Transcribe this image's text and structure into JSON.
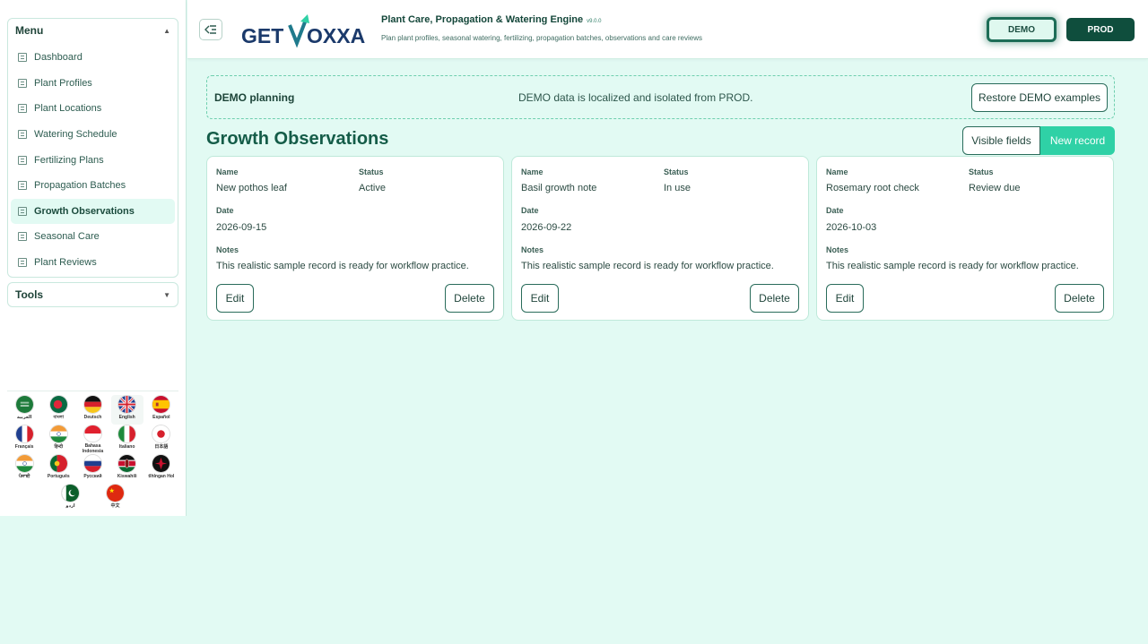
{
  "sidebar": {
    "menu_title": "Menu",
    "tools_title": "Tools",
    "items": [
      {
        "label": "Dashboard"
      },
      {
        "label": "Plant Profiles"
      },
      {
        "label": "Plant Locations"
      },
      {
        "label": "Watering Schedule"
      },
      {
        "label": "Fertilizing Plans"
      },
      {
        "label": "Propagation Batches"
      },
      {
        "label": "Growth Observations",
        "active": true
      },
      {
        "label": "Seasonal Care"
      },
      {
        "label": "Plant Reviews"
      }
    ],
    "languages": [
      {
        "label": "العربية",
        "flag": "saudi"
      },
      {
        "label": "বাংলা",
        "flag": "bangladesh"
      },
      {
        "label": "Deutsch",
        "flag": "germany"
      },
      {
        "label": "English",
        "flag": "uk",
        "selected": true
      },
      {
        "label": "Español",
        "flag": "spain"
      },
      {
        "label": "Français",
        "flag": "france"
      },
      {
        "label": "हिन्दी",
        "flag": "india"
      },
      {
        "label": "Bahasa Indonesia",
        "flag": "indonesia"
      },
      {
        "label": "Italiano",
        "flag": "italy"
      },
      {
        "label": "日本語",
        "flag": "japan"
      },
      {
        "label": "ਪੰਜਾਬੀ",
        "flag": "india"
      },
      {
        "label": "Português",
        "flag": "portugal"
      },
      {
        "label": "Русский",
        "flag": "russia"
      },
      {
        "label": "Kiswahili",
        "flag": "kenya"
      },
      {
        "label": "tlhIngan Hol",
        "flag": "klingon"
      },
      {
        "label": "اردو",
        "flag": "pakistan"
      },
      {
        "label": "中文",
        "flag": "china"
      }
    ]
  },
  "header": {
    "logo_text_a": "GET",
    "logo_text_b": "OXXA",
    "title": "Plant Care, Propagation & Watering Engine",
    "version": "v9.0.0",
    "subtitle": "Plan plant profiles, seasonal watering, fertilizing, propagation batches, observations and care reviews",
    "env_demo": "DEMO",
    "env_prod": "PROD"
  },
  "banner": {
    "title": "DEMO planning",
    "note": "DEMO data is localized and isolated from PROD.",
    "restore_label": "Restore DEMO examples"
  },
  "main": {
    "title": "Growth Observations",
    "visible_fields_label": "Visible fields",
    "new_record_label": "New record",
    "field_labels": {
      "name": "Name",
      "status": "Status",
      "date": "Date",
      "notes": "Notes"
    },
    "edit_label": "Edit",
    "delete_label": "Delete",
    "records": [
      {
        "name": "New pothos leaf",
        "status": "Active",
        "date": "2026-09-15",
        "notes": "This realistic sample record is ready for workflow practice."
      },
      {
        "name": "Basil growth note",
        "status": "In use",
        "date": "2026-09-22",
        "notes": "This realistic sample record is ready for workflow practice."
      },
      {
        "name": "Rosemary root check",
        "status": "Review due",
        "date": "2026-10-03",
        "notes": "This realistic sample record is ready for workflow practice."
      }
    ]
  },
  "colors": {
    "accent": "#2fd1a6",
    "dark": "#0f4e3d",
    "background": "#e2faf3"
  }
}
